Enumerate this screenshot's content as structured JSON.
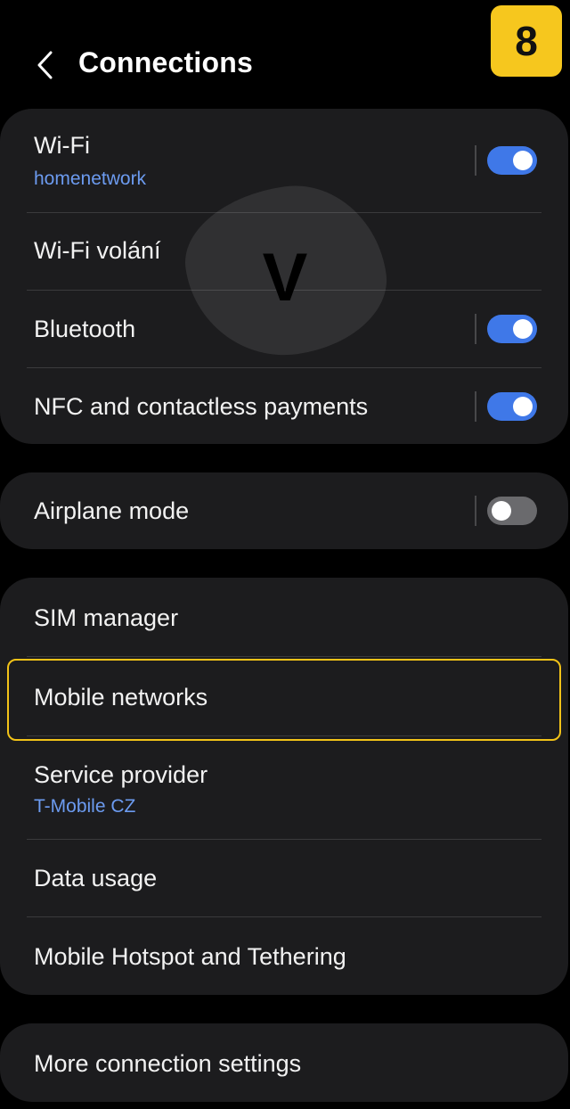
{
  "header": {
    "title": "Connections",
    "back_icon": "chevron-left-icon",
    "step_badge": "8"
  },
  "watermark": {
    "letter": "V"
  },
  "groups": {
    "wireless": {
      "wifi": {
        "title": "Wi-Fi",
        "subtitle": "homenetwork",
        "toggle": "on"
      },
      "wifi_calling": {
        "title": "Wi-Fi volání"
      },
      "bluetooth": {
        "title": "Bluetooth",
        "toggle": "on"
      },
      "nfc": {
        "title": "NFC and contactless payments",
        "toggle": "on"
      }
    },
    "airplane": {
      "airplane_mode": {
        "title": "Airplane mode",
        "toggle": "off"
      }
    },
    "mobile": {
      "sim_manager": {
        "title": "SIM manager"
      },
      "mobile_networks": {
        "title": "Mobile networks",
        "highlighted": true
      },
      "service_provider": {
        "title": "Service provider",
        "subtitle": "T-Mobile CZ"
      },
      "data_usage": {
        "title": "Data usage"
      },
      "hotspot": {
        "title": "Mobile Hotspot and Tethering"
      }
    },
    "more": {
      "more_settings": {
        "title": "More connection settings"
      }
    }
  },
  "colors": {
    "background": "#000000",
    "card": "#1c1c1e",
    "accent_blue": "#3f78e8",
    "subtitle_blue": "#6c9bf0",
    "highlight_yellow": "#f2c318",
    "badge_yellow": "#f6c71e"
  }
}
